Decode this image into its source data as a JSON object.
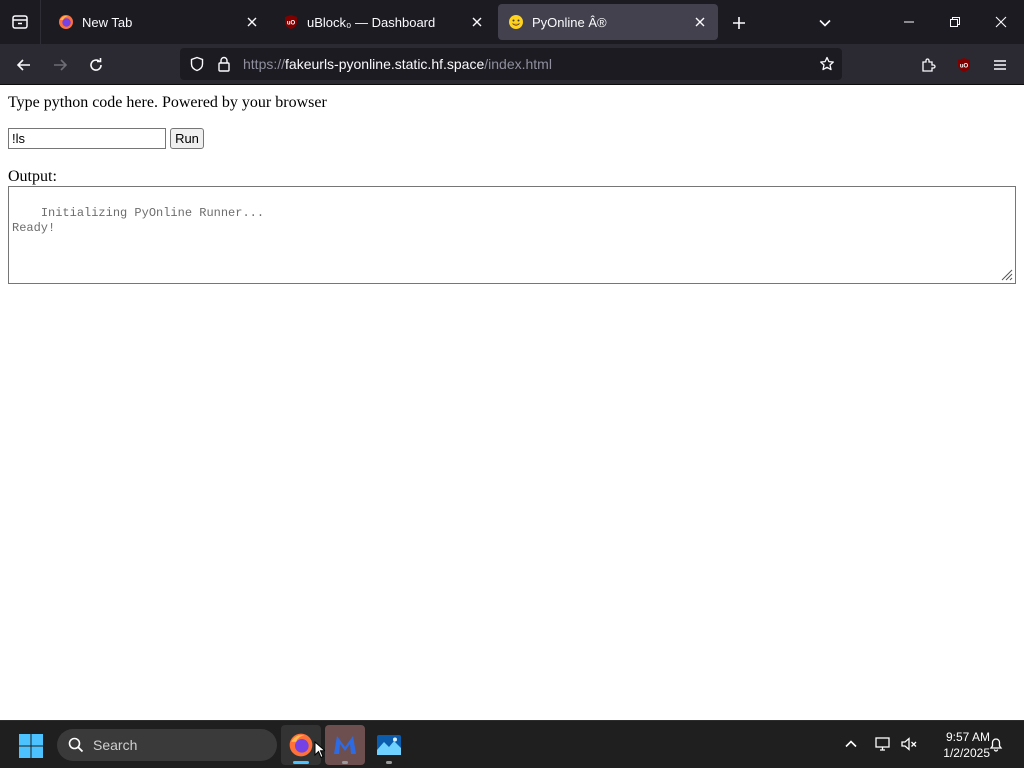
{
  "browser": {
    "tabs": [
      {
        "title": "New Tab",
        "icon": "firefox-icon",
        "active": false
      },
      {
        "title": "uBlock₀ — Dashboard",
        "icon": "ublock-icon",
        "active": false
      },
      {
        "title": "PyOnline Â®",
        "icon": "hugging-face-icon",
        "active": true
      }
    ],
    "url": {
      "scheme": "https://",
      "host": "fakeurls-pyonline.static.hf.space",
      "path": "/index.html"
    }
  },
  "page": {
    "intro_text": "Type python code here. Powered by your browser",
    "code_input_value": "!ls",
    "run_label": "Run",
    "output_label": "Output:",
    "output_text": "Initializing PyOnline Runner...\nReady!"
  },
  "taskbar": {
    "search_placeholder": "Search",
    "apps": [
      "firefox-icon",
      "malwarebytes-icon",
      "photos-icon"
    ],
    "time": "9:57 AM",
    "date": "1/2/2025"
  },
  "colors": {
    "chrome_dark": "#1c1b22",
    "toolbar": "#2b2a33",
    "active_tab": "#42414d",
    "taskbar": "#1f1f1f",
    "accent_blue": "#4cc2ff"
  }
}
